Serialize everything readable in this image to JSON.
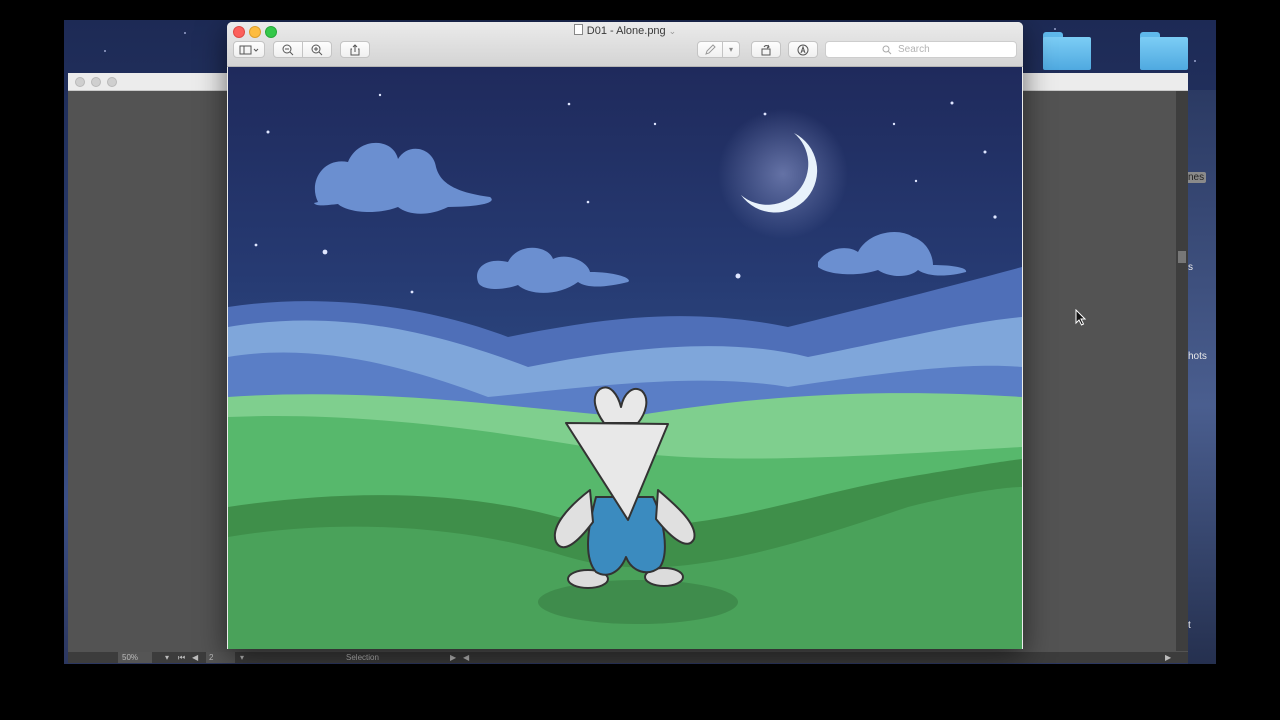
{
  "preview": {
    "title": "D01 - Alone.png",
    "search_placeholder": "Search"
  },
  "background_app": {
    "zoom": "50%",
    "page_number": "2",
    "tool_status": "Selection"
  },
  "desktop_labels": [
    "nes",
    "s",
    "hots",
    "t"
  ],
  "icons": {
    "sidebar": "sidebar-toggle-icon",
    "zoom_out": "zoom-out-icon",
    "zoom_in": "zoom-in-icon",
    "share": "share-icon",
    "markup_pen": "pen-icon",
    "rotate": "rotate-icon",
    "annotate": "markup-icon",
    "search": "search-icon"
  },
  "colors": {
    "close": "#fc605c",
    "minimize": "#fdbc40",
    "zoom": "#34c84a",
    "sky_top": "#1f2a5c",
    "sky_bottom": "#2d4a82",
    "moon": "#e8f2fb",
    "cloud": "#6b8fd0",
    "grass_light": "#7fcf8e",
    "grass_mid": "#57b86c",
    "grass_dark": "#3f8f4a",
    "character_body": "#e6e6e6",
    "character_pants": "#3b8bbf"
  }
}
